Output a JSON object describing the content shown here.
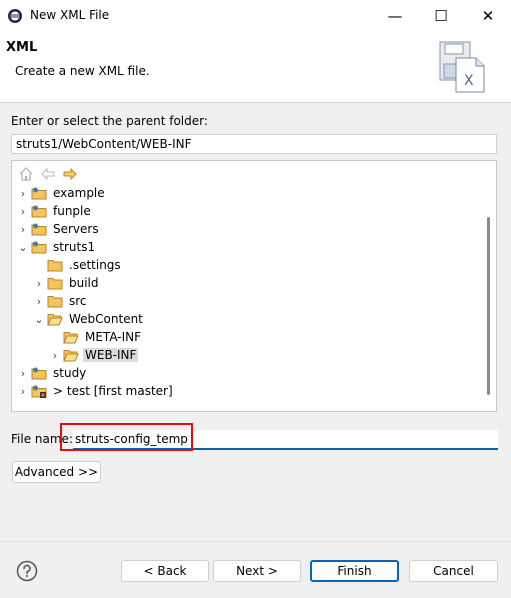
{
  "window": {
    "title": "New XML File",
    "minimize_icon": "—",
    "maximize_icon": "☐",
    "close_icon": "✕"
  },
  "header": {
    "title": "XML",
    "description": "Create a new XML file."
  },
  "parent_folder": {
    "label": "Enter or select the parent folder:",
    "value": "struts1/WebContent/WEB-INF"
  },
  "tree": {
    "nodes": [
      {
        "label": "example",
        "chevron": "›"
      },
      {
        "label": "funple",
        "chevron": "›"
      },
      {
        "label": "Servers",
        "chevron": "›"
      },
      {
        "label": "struts1",
        "chevron": "⌄"
      },
      {
        "label": ".settings",
        "chevron": ""
      },
      {
        "label": "build",
        "chevron": "›"
      },
      {
        "label": "src",
        "chevron": "›"
      },
      {
        "label": "WebContent",
        "chevron": "⌄"
      },
      {
        "label": "META-INF",
        "chevron": ""
      },
      {
        "label": "WEB-INF",
        "chevron": "›",
        "selected": true
      },
      {
        "label": "study",
        "chevron": "›"
      },
      {
        "label": "> test [first master]",
        "chevron": "›"
      }
    ]
  },
  "file_name": {
    "label": "File name:",
    "value": "struts-config_temp"
  },
  "buttons": {
    "advanced": "Advanced >>",
    "back": "< Back",
    "next": "Next >",
    "finish": "Finish",
    "cancel": "Cancel"
  },
  "colors": {
    "accent": "#0067c0",
    "highlight": "#e01010",
    "folder": "#f5c45a"
  }
}
